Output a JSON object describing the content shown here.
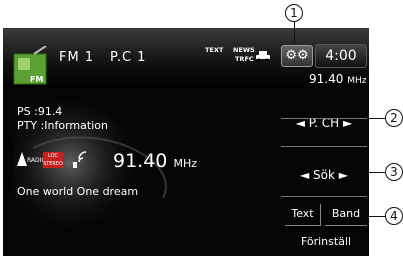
{
  "header": {
    "band": "FM 1",
    "preset": "P.C 1",
    "indicators": [
      "TEXT",
      "NEWS",
      "TRFC"
    ],
    "clock": "4:00",
    "frequency": "91.40",
    "unit": "MHz",
    "source_icon_label": "FM"
  },
  "info": {
    "ps": "PS  :91.4",
    "pty": "PTY :Information",
    "radio_tag": "RADIO",
    "loc_tag": "LOC",
    "stereo_tag": "STEREO",
    "frequency": "91.40",
    "unit": "MHz",
    "song": "One world One dream"
  },
  "controls": {
    "pch_label": "P. CH",
    "seek_label": "Sök",
    "text_button": "Text",
    "band_button": "Band",
    "preset_button": "Förinställ"
  },
  "callouts": [
    "1",
    "2",
    "3",
    "4"
  ],
  "colors": {
    "loc_badge": "#c62020",
    "background": "#050505",
    "icon_green": "#5aa032"
  }
}
